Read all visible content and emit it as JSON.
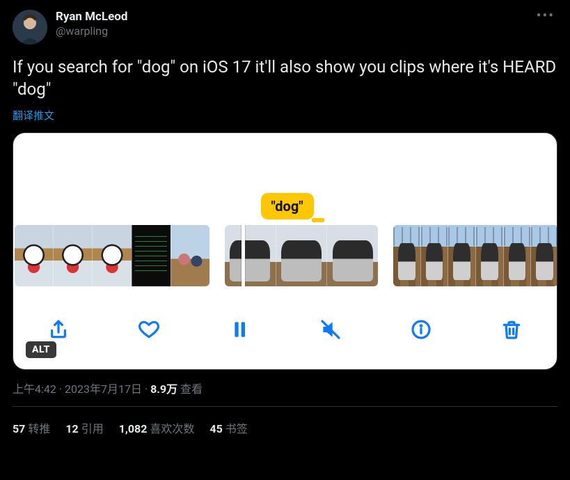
{
  "author": {
    "display_name": "Ryan McLeod",
    "handle": "@warpling"
  },
  "tweet_text": "If you search for \"dog\" on iOS 17 it'll also show you clips where it's HEARD \"dog\"",
  "translate_label": "翻译推文",
  "media": {
    "bubble_text": "\"dog\"",
    "alt_badge": "ALT"
  },
  "meta": {
    "time": "上午4:42",
    "sep1": " · ",
    "date": "2023年7月17日",
    "sep2": " · ",
    "views_number": "8.9万",
    "views_label": " 查看"
  },
  "stats": {
    "retweets_num": "57",
    "retweets_label": "转推",
    "quotes_num": "12",
    "quotes_label": "引用",
    "likes_num": "1,082",
    "likes_label": "喜欢次数",
    "bookmarks_num": "45",
    "bookmarks_label": "书签"
  },
  "icons": {
    "more": "more-icon",
    "share": "share-icon",
    "heart": "heart-icon",
    "pause": "pause-icon",
    "mute": "mute-icon",
    "info": "info-icon",
    "trash": "trash-icon"
  }
}
